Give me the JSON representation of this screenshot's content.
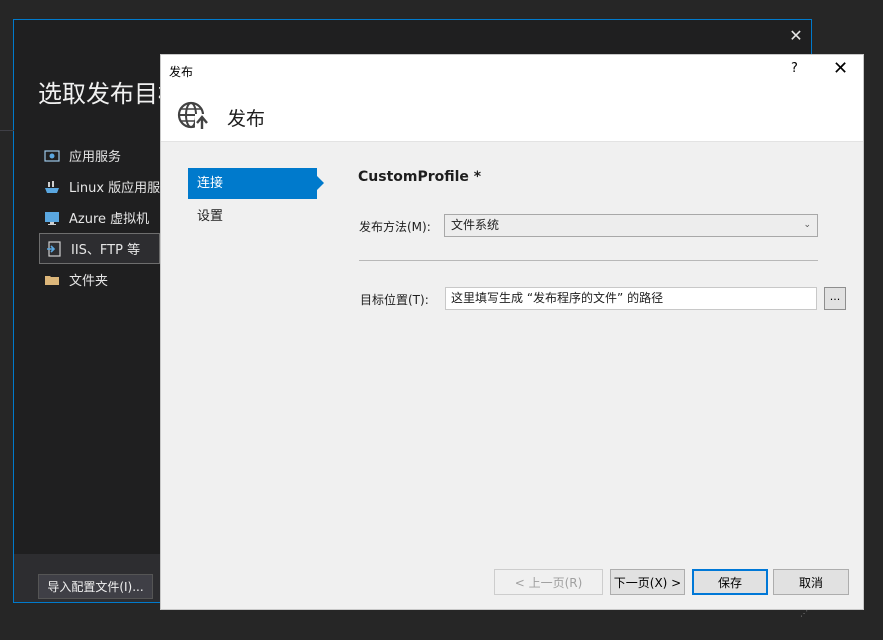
{
  "background_window": {
    "close_glyph": "✕",
    "title": "选取发布目标",
    "targets": [
      {
        "label": "应用服务",
        "icon": "app-service-icon"
      },
      {
        "label": "Linux 版应用服务",
        "icon": "linux-app-service-icon"
      },
      {
        "label": "Azure 虚拟机",
        "icon": "azure-vm-icon"
      },
      {
        "label": "IIS、FTP 等",
        "icon": "iis-ftp-icon"
      },
      {
        "label": "文件夹",
        "icon": "folder-icon"
      }
    ],
    "import_button": "导入配置文件(I)..."
  },
  "dialog": {
    "title": "发布",
    "help_glyph": "?",
    "close_glyph": "✕",
    "header_title": "发布",
    "nav": [
      {
        "label": "连接",
        "active": true
      },
      {
        "label": "设置",
        "active": false
      }
    ],
    "profile_name": "CustomProfile *",
    "method_label": "发布方法(M):",
    "method_value": "文件系统",
    "target_label": "目标位置(T):",
    "target_value": "这里填写生成 “发布程序的文件” 的路径",
    "browse_label": "...",
    "buttons": {
      "prev": "< 上一页(R)",
      "next": "下一页(X) >",
      "save": "保存",
      "cancel": "取消"
    }
  },
  "colors": {
    "accent": "#007acc",
    "dark_bg": "#1f1f20"
  }
}
